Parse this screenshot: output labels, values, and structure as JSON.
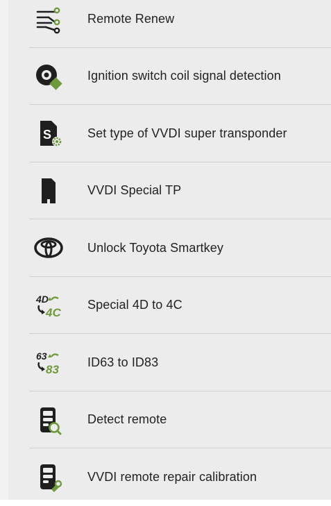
{
  "colors": {
    "icon_dark": "#1f1f1f",
    "accent_green": "#6f9a3c",
    "panel_bg": "#ececec",
    "divider": "#cfcfcf"
  },
  "menu": {
    "items": [
      {
        "label": "Remote Renew",
        "icon": "circuit-icon"
      },
      {
        "label": "Ignition switch coil signal detection",
        "icon": "coil-detect-icon"
      },
      {
        "label": "Set type of VVDI super transponder",
        "icon": "transponder-settings-icon"
      },
      {
        "label": "VVDI Special TP",
        "icon": "special-tp-icon"
      },
      {
        "label": "Unlock Toyota Smartkey",
        "icon": "toyota-logo-icon"
      },
      {
        "label": "Special 4D to 4C",
        "icon": "4d-to-4c-icon",
        "icon_top": "4D",
        "icon_bottom": "4C"
      },
      {
        "label": "ID63 to ID83",
        "icon": "id63-to-id83-icon",
        "icon_top": "63",
        "icon_bottom": "83"
      },
      {
        "label": "Detect remote",
        "icon": "remote-detect-icon"
      },
      {
        "label": "VVDI remote repair calibration",
        "icon": "remote-repair-icon"
      }
    ]
  }
}
